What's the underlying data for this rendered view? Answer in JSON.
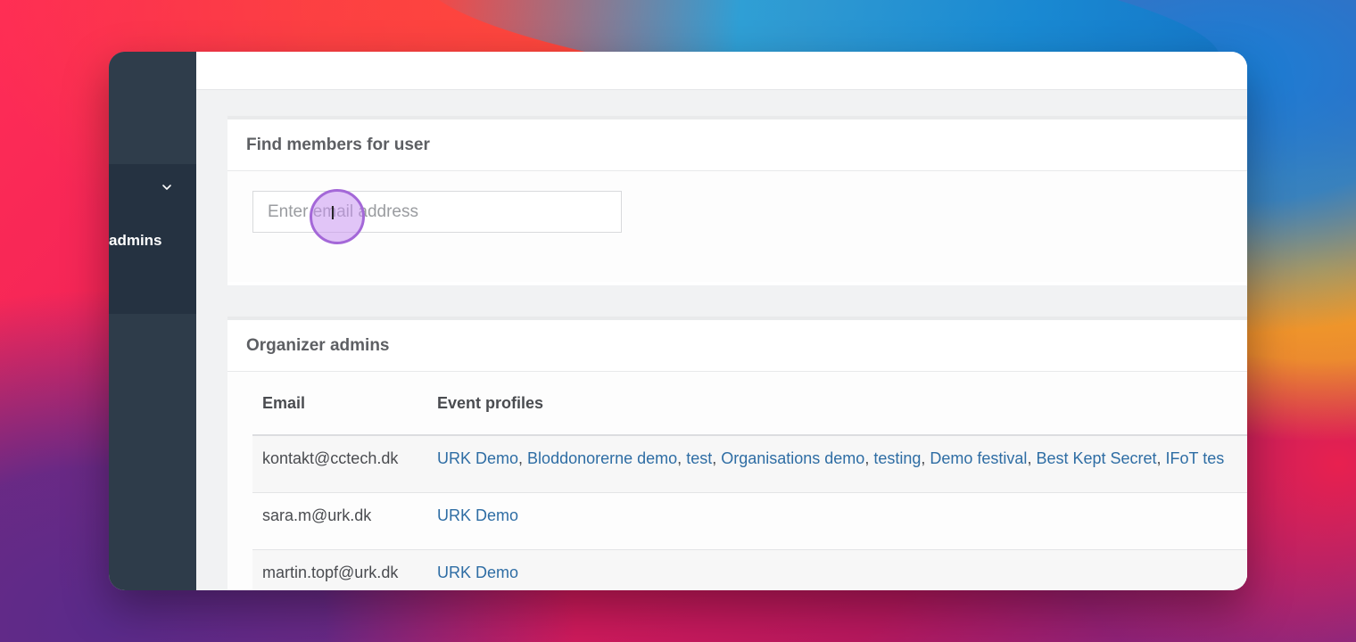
{
  "colors": {
    "sidebar": "#2e3c4a",
    "link": "#2e6da4",
    "cursor_highlight": "#a468d8"
  },
  "sidebar": {
    "active_group_label": "admins",
    "chevron_icon": "chevron-down-icon"
  },
  "find_panel": {
    "title": "Find members for user",
    "input_placeholder": "Enter email address",
    "input_value": ""
  },
  "admins_panel": {
    "title": "Organizer admins",
    "columns": [
      "Email",
      "Event profiles"
    ],
    "rows": [
      {
        "email": "kontakt@cctech.dk",
        "profiles": [
          "URK Demo",
          "Bloddonorerne demo",
          "test",
          "Organisations demo",
          "testing",
          "Demo festival",
          "Best Kept Secret",
          "IFoT tes"
        ]
      },
      {
        "email": "sara.m@urk.dk",
        "profiles": [
          "URK Demo"
        ]
      },
      {
        "email": "martin.topf@urk.dk",
        "profiles": [
          "URK Demo"
        ]
      }
    ]
  }
}
